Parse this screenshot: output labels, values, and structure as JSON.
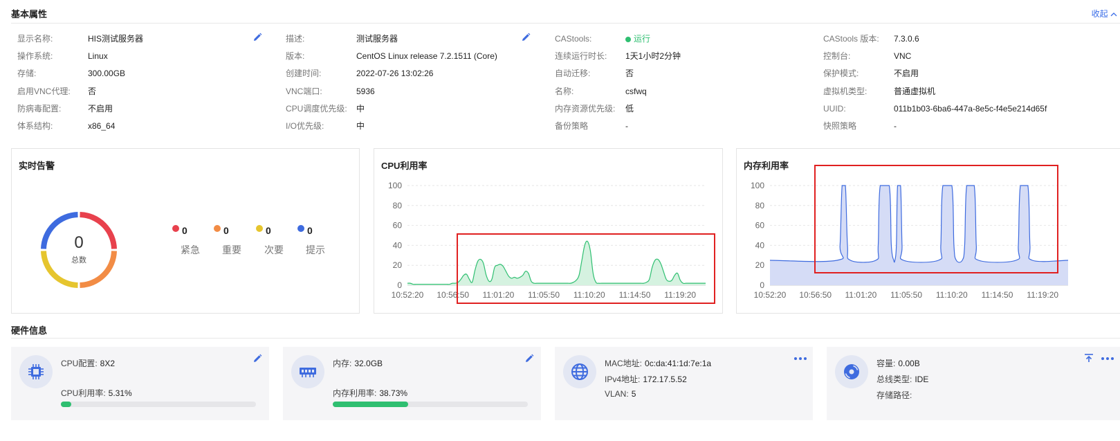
{
  "basic": {
    "title": "基本属性",
    "collapse": "收起",
    "col1": [
      {
        "label": "显示名称:",
        "value": "HIS测试服务器"
      },
      {
        "label": "操作系统:",
        "value": "Linux"
      },
      {
        "label": "存储:",
        "value": "300.00GB"
      },
      {
        "label": "启用VNC代理:",
        "value": "否"
      },
      {
        "label": "防病毒配置:",
        "value": "不启用"
      },
      {
        "label": "体系结构:",
        "value": "x86_64"
      }
    ],
    "col2": [
      {
        "label": "描述:",
        "value": "测试服务器"
      },
      {
        "label": "版本:",
        "value": "CentOS Linux release 7.2.1511 (Core)"
      },
      {
        "label": "创建时间:",
        "value": "2022-07-26 13:02:26"
      },
      {
        "label": "VNC端口:",
        "value": "5936"
      },
      {
        "label": "CPU调度优先级:",
        "value": "中"
      },
      {
        "label": "I/O优先级:",
        "value": "中"
      }
    ],
    "col3": [
      {
        "label": "CAStools:",
        "value": "运行"
      },
      {
        "label": "连续运行时长:",
        "value": "1天1小时2分钟"
      },
      {
        "label": "自动迁移:",
        "value": "否"
      },
      {
        "label": "名称:",
        "value": "csfwq"
      },
      {
        "label": "内存资源优先级:",
        "value": "低"
      },
      {
        "label": "备份策略",
        "value": "-"
      }
    ],
    "col4": [
      {
        "label": "CAStools 版本:",
        "value": "7.3.0.6"
      },
      {
        "label": "控制台:",
        "value": "VNC"
      },
      {
        "label": "保护模式:",
        "value": "不启用"
      },
      {
        "label": "虚拟机类型:",
        "value": "普通虚拟机"
      },
      {
        "label": "UUID:",
        "value": "011b1b03-6ba6-447a-8e5c-f4e5e214d65f"
      },
      {
        "label": "快照策略",
        "value": "-"
      }
    ],
    "status_color": "#2fbf71"
  },
  "alarm": {
    "title": "实时告警",
    "total": "0",
    "total_label": "总数",
    "items": [
      {
        "count": "0",
        "label": "紧急",
        "color": "#e8414d"
      },
      {
        "count": "0",
        "label": "重要",
        "color": "#f28c45"
      },
      {
        "count": "0",
        "label": "次要",
        "color": "#e6c52e"
      },
      {
        "count": "0",
        "label": "提示",
        "color": "#3e6bdf"
      }
    ]
  },
  "cpu_chart": {
    "title": "CPU利用率",
    "chart_data": {
      "type": "area",
      "x_ticks": [
        "10:52:20",
        "10:56:50",
        "11:01:20",
        "11:05:50",
        "11:10:20",
        "11:14:50",
        "11:19:20"
      ],
      "y_ticks": [
        0,
        20,
        40,
        60,
        80,
        100
      ],
      "ylim": [
        0,
        100
      ],
      "grid": true,
      "color": "#2fbf71",
      "fill": "#d5f2e0",
      "values": [
        2,
        2,
        1,
        1,
        1,
        1,
        1,
        1,
        1,
        1,
        1,
        1,
        1,
        1,
        1,
        1,
        2,
        2,
        3,
        6,
        10,
        11,
        6,
        3,
        15,
        24,
        26,
        22,
        10,
        4,
        6,
        18,
        20,
        21,
        19,
        14,
        9,
        7,
        8,
        7,
        8,
        10,
        14,
        12,
        4,
        2,
        2,
        2,
        2,
        2,
        2,
        2,
        2,
        2,
        2,
        2,
        2,
        2,
        2,
        3,
        5,
        10,
        25,
        40,
        44,
        35,
        12,
        3,
        2,
        2,
        2,
        2,
        2,
        2,
        2,
        2,
        2,
        2,
        2,
        2,
        2,
        2,
        2,
        2,
        2,
        3,
        6,
        18,
        25,
        26,
        22,
        14,
        6,
        4,
        5,
        10,
        12,
        5,
        2,
        2,
        2,
        2,
        2,
        2,
        2,
        2,
        2
      ]
    }
  },
  "mem_chart": {
    "title": "内存利用率",
    "chart_data": {
      "type": "area",
      "x_ticks": [
        "10:52:20",
        "10:56:50",
        "11:01:20",
        "11:05:50",
        "11:10:20",
        "11:14:50",
        "11:19:20"
      ],
      "y_ticks": [
        0,
        20,
        40,
        60,
        80,
        100
      ],
      "ylim": [
        0,
        100
      ],
      "grid": true,
      "color": "#3e6bdf",
      "fill": "#d5dcf6",
      "points": [
        [
          0,
          25
        ],
        [
          22.5,
          25
        ],
        [
          23.5,
          40
        ],
        [
          24.2,
          100
        ],
        [
          25.3,
          100
        ],
        [
          26.0,
          40
        ],
        [
          27.0,
          25
        ],
        [
          35.5,
          25
        ],
        [
          36.3,
          40
        ],
        [
          37.0,
          100
        ],
        [
          40.0,
          100
        ],
        [
          40.7,
          40
        ],
        [
          41.5,
          25
        ],
        [
          41.9,
          25
        ],
        [
          42.4,
          40
        ],
        [
          42.8,
          100
        ],
        [
          43.8,
          100
        ],
        [
          44.3,
          40
        ],
        [
          44.8,
          25
        ],
        [
          56.5,
          25
        ],
        [
          57.3,
          40
        ],
        [
          58.0,
          100
        ],
        [
          61.0,
          100
        ],
        [
          61.7,
          40
        ],
        [
          62.5,
          25
        ],
        [
          64.5,
          25
        ],
        [
          65.3,
          40
        ],
        [
          66.0,
          100
        ],
        [
          68.5,
          100
        ],
        [
          69.2,
          40
        ],
        [
          70.0,
          25
        ],
        [
          82.5,
          25
        ],
        [
          83.3,
          40
        ],
        [
          84.0,
          100
        ],
        [
          86.5,
          100
        ],
        [
          87.2,
          40
        ],
        [
          88.0,
          25
        ],
        [
          100,
          25
        ]
      ]
    }
  },
  "hardware": {
    "title": "硬件信息",
    "cpu": {
      "config_label": "CPU配置:",
      "config_value": "8X2",
      "usage_label": "CPU利用率:",
      "usage_value": "5.31%",
      "usage_fraction": 0.0531
    },
    "memory": {
      "mem_label": "内存:",
      "mem_value": "32.0GB",
      "usage_label": "内存利用率:",
      "usage_value": "38.73%",
      "usage_fraction": 0.3873
    },
    "network": {
      "mac_label": "MAC地址:",
      "mac_value": "0c:da:41:1d:7e:1a",
      "ipv4_label": "IPv4地址:",
      "ipv4_value": "172.17.5.52",
      "vlan_label": "VLAN:",
      "vlan_value": "5"
    },
    "disk": {
      "capacity_label": "容量:",
      "capacity_value": "0.00B",
      "bus_label": "总线类型:",
      "bus_value": "IDE",
      "path_label": "存储路径:",
      "path_value": ""
    }
  }
}
